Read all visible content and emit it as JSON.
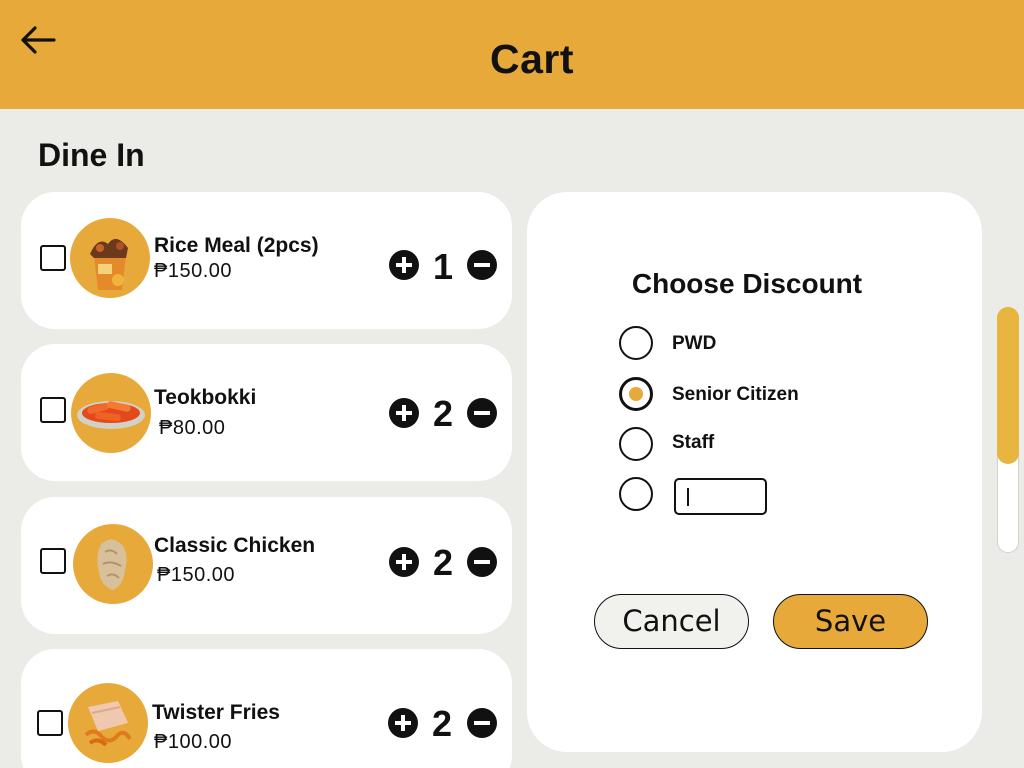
{
  "header": {
    "title": "Cart",
    "back_icon": "arrow-left-icon"
  },
  "section_title": "Dine In",
  "items": [
    {
      "name": "Rice Meal (2pcs)",
      "price": "₱150.00",
      "qty": "1",
      "checked": false
    },
    {
      "name": "Teokbokki",
      "price": "₱80.00",
      "qty": "2",
      "checked": false
    },
    {
      "name": "Classic Chicken",
      "price": "₱150.00",
      "qty": "2",
      "checked": false
    },
    {
      "name": "Twister Fries",
      "price": "₱100.00",
      "qty": "2",
      "checked": false
    }
  ],
  "discount": {
    "title": "Choose Discount",
    "options": [
      {
        "label": "PWD",
        "selected": false
      },
      {
        "label": "Senior Citizen",
        "selected": true
      },
      {
        "label": "Staff",
        "selected": false
      },
      {
        "label": "",
        "selected": false
      }
    ],
    "other_value": "",
    "cancel_label": "Cancel",
    "save_label": "Save"
  },
  "colors": {
    "accent": "#e8a93b",
    "background": "#ebebe7",
    "card": "#ffffff"
  }
}
